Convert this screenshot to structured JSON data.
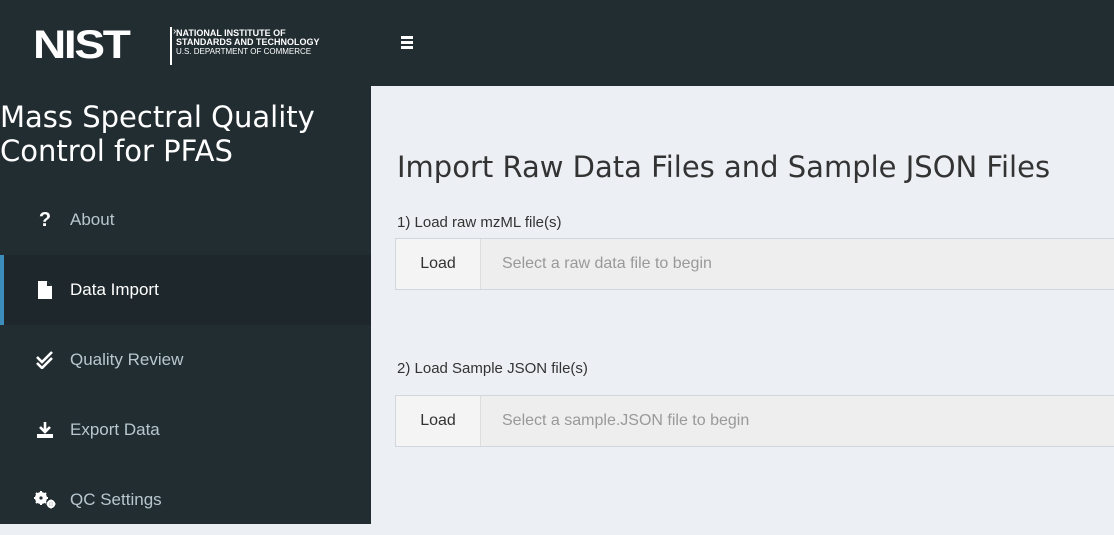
{
  "header": {
    "logo_word": "NIST",
    "logo_line1": "NATIONAL INSTITUTE OF",
    "logo_line2": "STANDARDS AND TECHNOLOGY",
    "logo_line3": "U.S. DEPARTMENT OF COMMERCE"
  },
  "sidebar": {
    "title_line1": "Mass Spectral Quality",
    "title_line2": "Control for PFAS",
    "items": [
      {
        "label": "About",
        "icon": "question-icon",
        "active": false
      },
      {
        "label": "Data Import",
        "icon": "file-icon",
        "active": true
      },
      {
        "label": "Quality Review",
        "icon": "double-check-icon",
        "active": false
      },
      {
        "label": "Export Data",
        "icon": "download-icon",
        "active": false
      },
      {
        "label": "QC Settings",
        "icon": "cogs-icon",
        "active": false
      }
    ]
  },
  "main": {
    "title": "Import Raw Data Files and Sample JSON Files",
    "raw": {
      "label": "1) Load raw mzML file(s)",
      "button": "Load",
      "placeholder": "Select a raw data file to begin"
    },
    "sample": {
      "label": "2) Load Sample JSON file(s)",
      "button": "Load",
      "placeholder": "Select a sample.JSON file to begin"
    }
  },
  "colors": {
    "sidebar_bg": "#222d32",
    "active_bg": "#1e282c",
    "accent": "#3c8dbc",
    "content_bg": "#ecf0f5"
  }
}
